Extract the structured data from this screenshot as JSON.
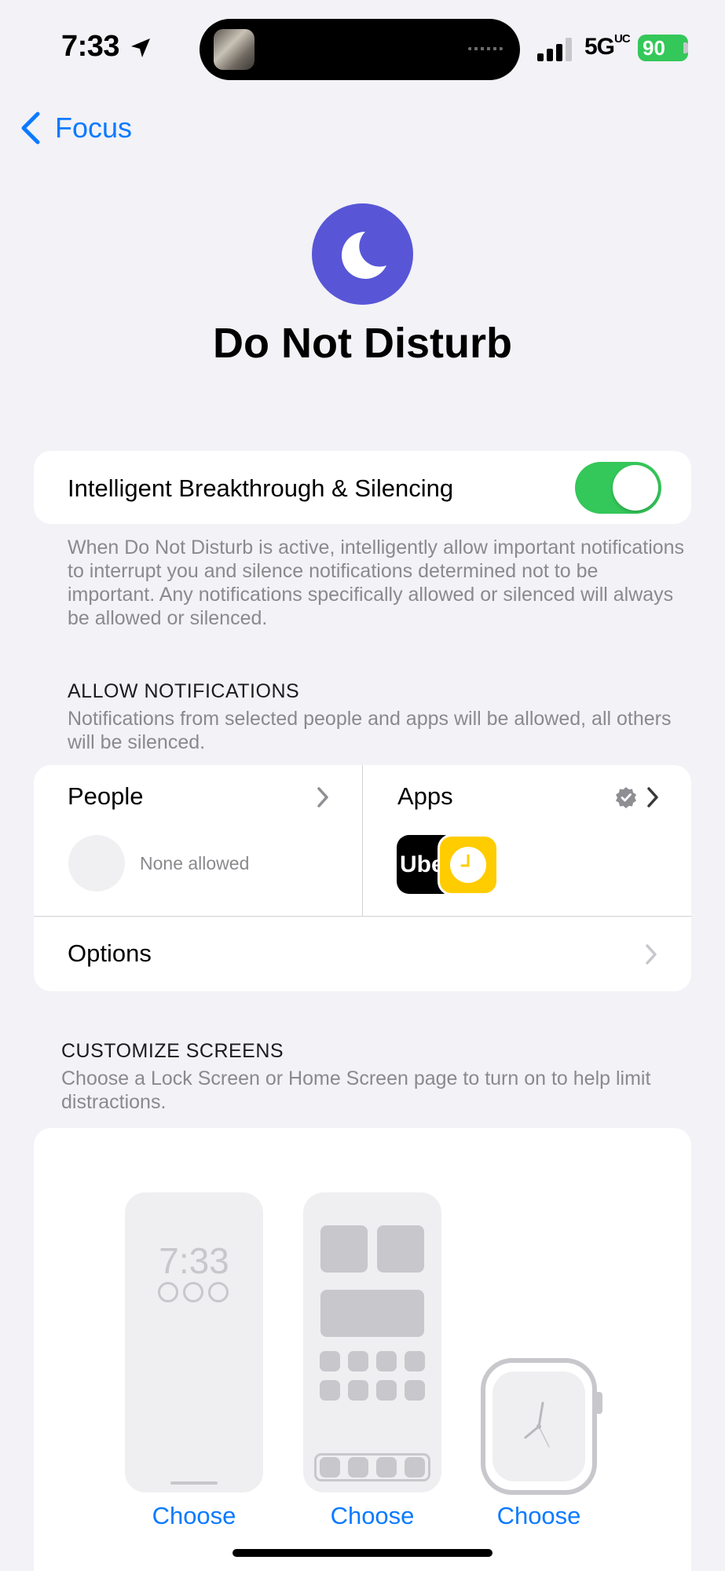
{
  "status_bar": {
    "time": "7:33",
    "network": "5G",
    "network_suffix": "UC",
    "battery": "90"
  },
  "nav": {
    "back_label": "Focus"
  },
  "header": {
    "title": "Do Not Disturb",
    "icon": "moon-icon",
    "icon_color": "#5856d6"
  },
  "intelligent": {
    "label": "Intelligent Breakthrough & Silencing",
    "enabled": true,
    "description": "When Do Not Disturb is active, intelligently allow important notifications to interrupt you and silence notifications determined not to be important. Any notifications specifically allowed or silenced will always be allowed or silenced."
  },
  "allow_notifications": {
    "heading": "ALLOW NOTIFICATIONS",
    "description": "Notifications from selected people and apps will be allowed, all others will be silenced.",
    "people_label": "People",
    "people_value": "None allowed",
    "apps_label": "Apps",
    "apps": [
      {
        "name": "Uber",
        "label": "Uber",
        "color": "#000000"
      },
      {
        "name": "Clock",
        "icon": "clock-icon",
        "color": "#ffcc00"
      }
    ],
    "options_label": "Options"
  },
  "customize_screens": {
    "heading": "CUSTOMIZE SCREENS",
    "description": "Choose a Lock Screen or Home Screen page to turn on to help limit distractions.",
    "lock_preview_time": "7:33",
    "choose_label": "Choose"
  },
  "colors": {
    "accent": "#0a7aff",
    "toggle_on": "#34c759",
    "background": "#f2f2f7"
  }
}
